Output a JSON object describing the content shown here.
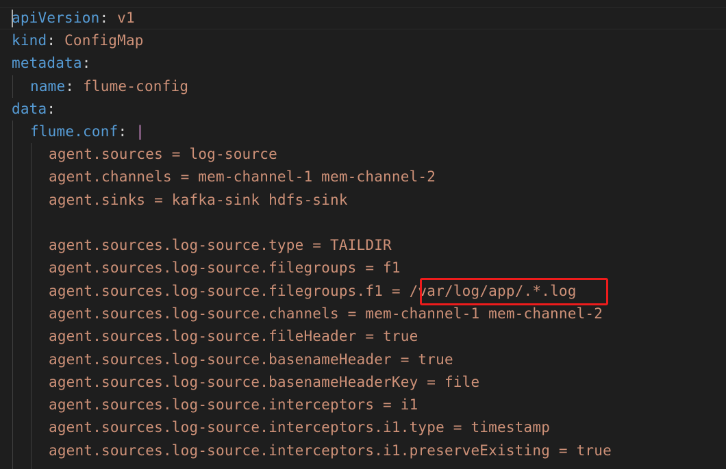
{
  "file": {
    "lines": [
      {
        "key": "apiVersion",
        "sep": ": ",
        "value": "v1"
      },
      {
        "key": "kind",
        "sep": ": ",
        "value": "ConfigMap"
      },
      {
        "key": "metadata",
        "sep": ":",
        "value": ""
      },
      {
        "key": "name",
        "sep": ": ",
        "value": "flume-config"
      },
      {
        "key": "data",
        "sep": ":",
        "value": ""
      },
      {
        "key": "flume.conf",
        "sep": ": ",
        "value": "|"
      }
    ],
    "block": [
      "agent.sources = log-source",
      "agent.channels = mem-channel-1 mem-channel-2",
      "agent.sinks = kafka-sink hdfs-sink",
      "",
      "agent.sources.log-source.type = TAILDIR",
      "agent.sources.log-source.filegroups = f1",
      "agent.sources.log-source.filegroups.f1 = ",
      "agent.sources.log-source.channels = mem-channel-1 mem-channel-2",
      "agent.sources.log-source.fileHeader = true",
      "agent.sources.log-source.basenameHeader = true",
      "agent.sources.log-source.basenameHeaderKey = file",
      "agent.sources.log-source.interceptors = i1",
      "agent.sources.log-source.interceptors.i1.type = timestamp",
      "agent.sources.log-source.interceptors.i1.preserveExisting = true"
    ],
    "highlighted_value": "/var/log/app/.*.log"
  },
  "colors": {
    "background": "#1e1e1e",
    "key": "#569cd6",
    "string": "#ce9178",
    "punctuation": "#d4d4d4",
    "block_indicator": "#c586c0",
    "annotation_box": "#ee1c1c"
  }
}
